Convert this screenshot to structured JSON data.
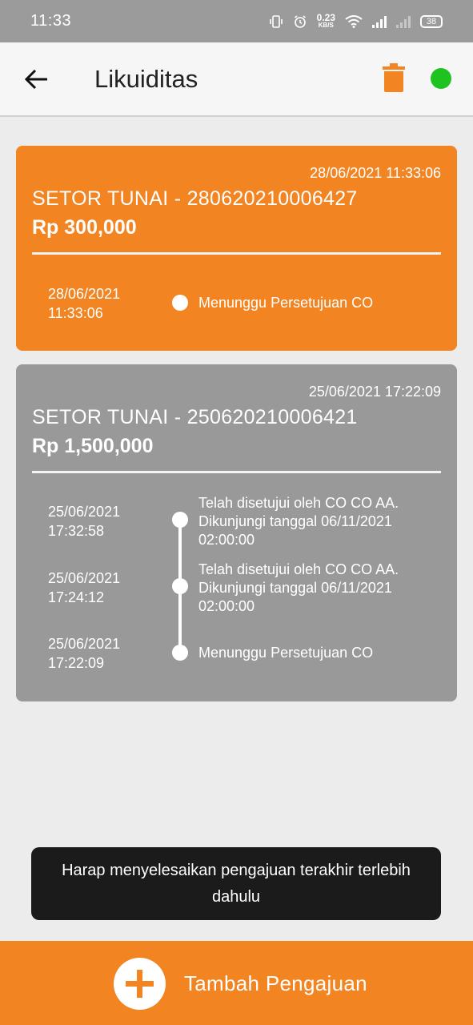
{
  "status_bar": {
    "time": "11:33",
    "net_speed_value": "0.23",
    "net_speed_unit": "KB/S",
    "battery": "38"
  },
  "app_bar": {
    "title": "Likuiditas",
    "status_color": "#1fc31f"
  },
  "colors": {
    "accent": "#f28422",
    "inactive_card": "#999999"
  },
  "cards": [
    {
      "timestamp": "28/06/2021 11:33:06",
      "title": "SETOR TUNAI - 280620210006427",
      "amount": "Rp 300,000",
      "timeline": [
        {
          "date": "28/06/2021",
          "time": "11:33:06",
          "text": "Menunggu Persetujuan CO"
        }
      ]
    },
    {
      "timestamp": "25/06/2021 17:22:09",
      "title": "SETOR TUNAI - 250620210006421",
      "amount": "Rp 1,500,000",
      "timeline": [
        {
          "date": "25/06/2021",
          "time": "17:32:58",
          "text": "Telah disetujui oleh CO CO AA. Dikunjungi tanggal 06/11/2021 02:00:00"
        },
        {
          "date": "25/06/2021",
          "time": "17:24:12",
          "text": "Telah disetujui oleh CO CO AA. Dikunjungi tanggal 06/11/2021 02:00:00"
        },
        {
          "date": "25/06/2021",
          "time": "17:22:09",
          "text": "Menunggu Persetujuan CO"
        }
      ]
    }
  ],
  "toast": {
    "message": "Harap menyelesaikan pengajuan terakhir terlebih dahulu"
  },
  "bottom_bar": {
    "add_label": "Tambah Pengajuan"
  }
}
